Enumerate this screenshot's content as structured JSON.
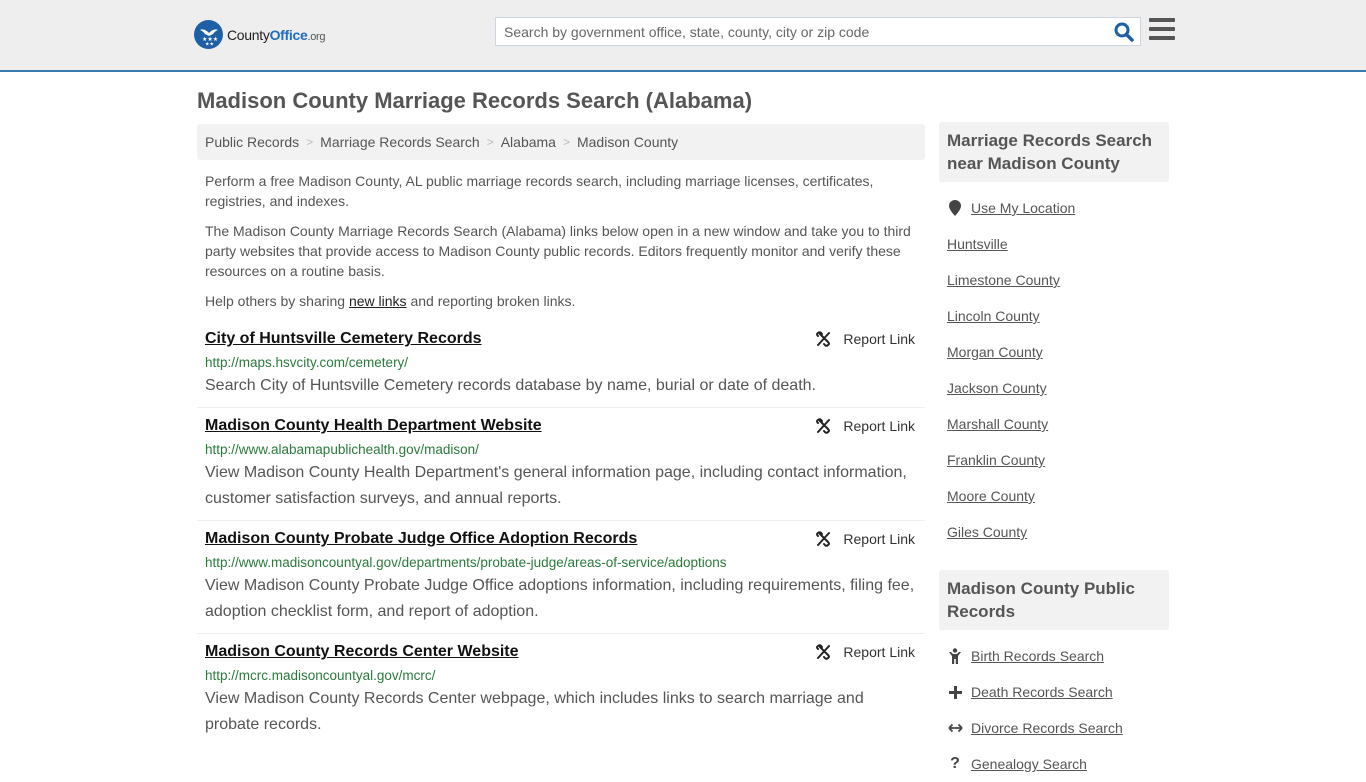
{
  "header": {
    "logo": {
      "county": "County",
      "office": "Office",
      "tld": ".org"
    },
    "search": {
      "placeholder": "Search by government office, state, county, city or zip code",
      "value": ""
    },
    "colors": {
      "accent": "#3a7cb0",
      "logo": "#1f5fa6"
    }
  },
  "page": {
    "title": "Madison County Marriage Records Search (Alabama)"
  },
  "breadcrumb": [
    {
      "label": "Public Records"
    },
    {
      "label": "Marriage Records Search"
    },
    {
      "label": "Alabama"
    },
    {
      "label": "Madison County"
    }
  ],
  "intro": {
    "p1": "Perform a free Madison County, AL public marriage records search, including marriage licenses, certificates, registries, and indexes.",
    "p2": "The Madison County Marriage Records Search (Alabama) links below open in a new window and take you to third party websites that provide access to Madison County public records. Editors frequently monitor and verify these resources on a routine basis.",
    "p3_before": "Help others by sharing ",
    "p3_link": "new links",
    "p3_after": " and reporting broken links."
  },
  "results": [
    {
      "title": "City of Huntsville Cemetery Records",
      "url": "http://maps.hsvcity.com/cemetery/",
      "description": "Search City of Huntsville Cemetery records database by name, burial or date of death.",
      "report_label": "Report Link"
    },
    {
      "title": "Madison County Health Department Website",
      "url": "http://www.alabamapublichealth.gov/madison/",
      "description": "View Madison County Health Department's general information page, including contact information, customer satisfaction surveys, and annual reports.",
      "report_label": "Report Link"
    },
    {
      "title": "Madison County Probate Judge Office Adoption Records",
      "url": "http://www.madisoncountyal.gov/departments/probate-judge/areas-of-service/adoptions",
      "description": "View Madison County Probate Judge Office adoptions information, including requirements, filing fee, adoption checklist form, and report of adoption.",
      "report_label": "Report Link"
    },
    {
      "title": "Madison County Records Center Website",
      "url": "http://mcrc.madisoncountyal.gov/mcrc/",
      "description": "View Madison County Records Center webpage, which includes links to search marriage and probate records.",
      "report_label": "Report Link"
    }
  ],
  "sidebar": {
    "nearby": {
      "heading": "Marriage Records Search near Madison County",
      "use_location": "Use My Location",
      "items": [
        "Huntsville",
        "Limestone County",
        "Lincoln County",
        "Morgan County",
        "Jackson County",
        "Marshall County",
        "Franklin County",
        "Moore County",
        "Giles County"
      ]
    },
    "public_records": {
      "heading": "Madison County Public Records",
      "items": [
        {
          "label": "Birth Records Search",
          "icon": "child-icon"
        },
        {
          "label": "Death Records Search",
          "icon": "plus-icon"
        },
        {
          "label": "Divorce Records Search",
          "icon": "arrows-horizontal-icon"
        },
        {
          "label": "Genealogy Search",
          "icon": "question-icon"
        }
      ]
    }
  }
}
